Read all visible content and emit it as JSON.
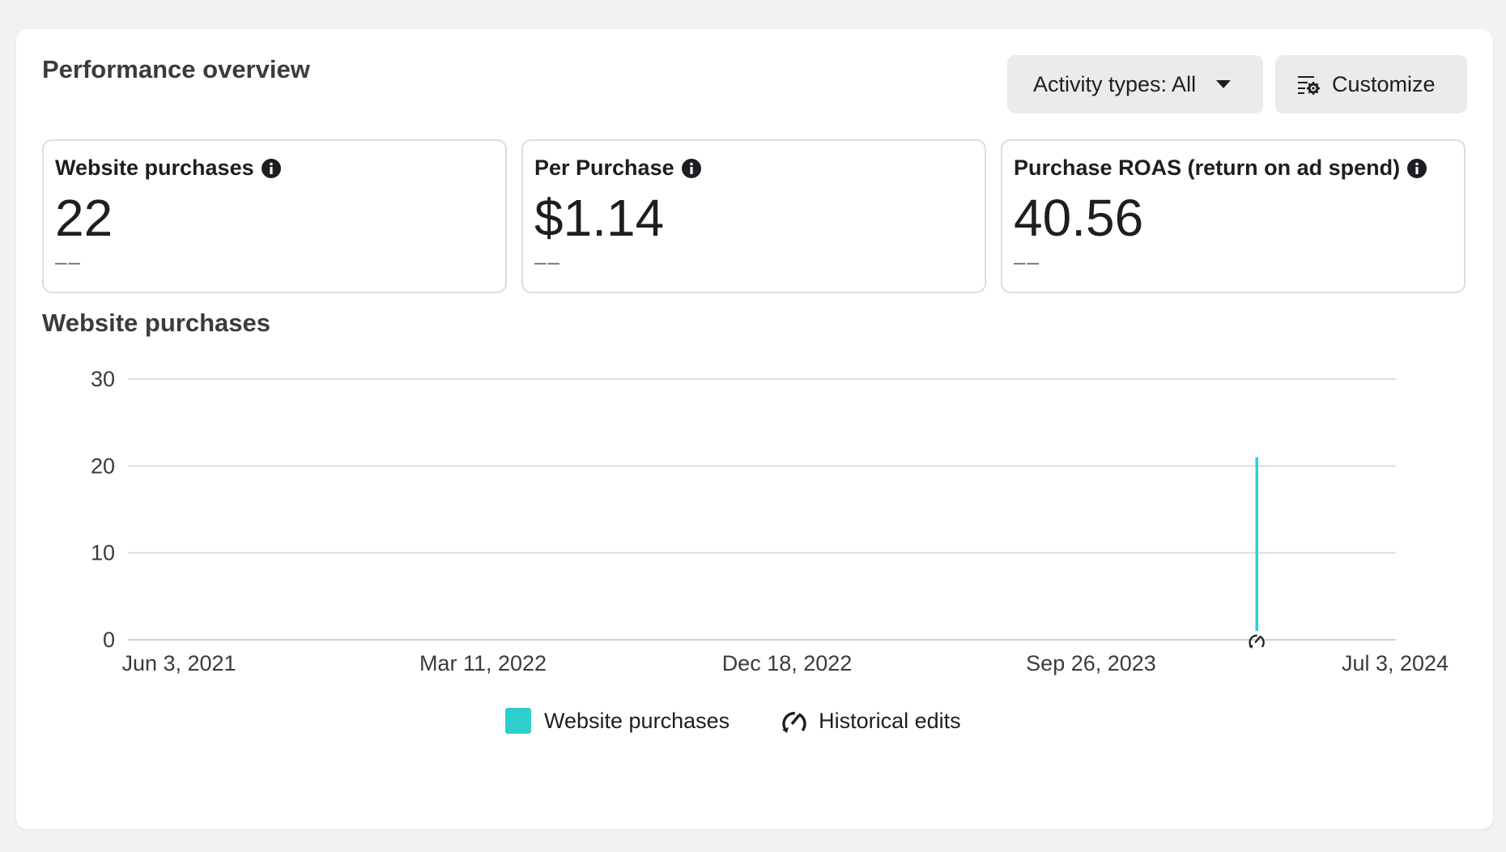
{
  "header": {
    "title": "Performance overview",
    "activity_button": "Activity types: All",
    "customize_button": "Customize"
  },
  "metrics": [
    {
      "label": "Website purchases",
      "value": "22",
      "delta": "––"
    },
    {
      "label": "Per Purchase",
      "value": "$1.14",
      "delta": "––"
    },
    {
      "label": "Purchase ROAS (return on ad spend)",
      "value": "40.56",
      "delta": "––"
    }
  ],
  "chart_section": {
    "title": "Website purchases"
  },
  "chart_data": {
    "type": "line",
    "title": "Website purchases",
    "x_ticks": [
      "Jun 3, 2021",
      "Mar 11, 2022",
      "Dec 18, 2022",
      "Sep 26, 2023",
      "Jul 3, 2024"
    ],
    "y_ticks": [
      0,
      10,
      20,
      30
    ],
    "ylim": [
      0,
      30
    ],
    "xlim": [
      "2021-06-03",
      "2024-07-03"
    ],
    "series": [
      {
        "name": "Website purchases",
        "color": "#2ecfce",
        "points": [
          {
            "x": "2024-02-26",
            "y": 1
          },
          {
            "x": "2024-02-26",
            "y": 21
          }
        ]
      }
    ],
    "annotations": [
      {
        "type": "historical-edit",
        "x": "2024-02-26"
      }
    ],
    "grid": true
  },
  "legend": {
    "purchases": "Website purchases",
    "edits": "Historical edits"
  },
  "icons": {
    "info": "info-icon",
    "caret": "caret-down-icon",
    "customize": "customize-icon",
    "edits": "historical-edit-icon"
  },
  "colors": {
    "accent": "#2ecfce",
    "background": "#f2f2f2",
    "card": "#ffffff",
    "button": "#ebebeb"
  }
}
